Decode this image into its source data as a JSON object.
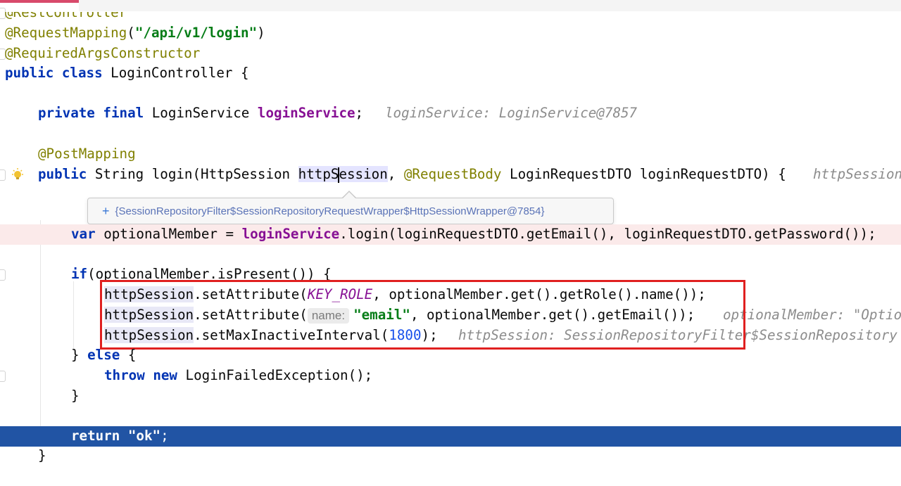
{
  "editor": {
    "lines": {
      "l1_annotation": "@RestController",
      "l2_annotation": "@RequestMapping",
      "l2_open": "(",
      "l2_path": "\"/api/v1/login\"",
      "l2_close": ")",
      "l3_annotation": "@RequiredArgsConstructor",
      "l4_kw": "public class",
      "l4_rest": " LoginController {",
      "l6_kw": "private final",
      "l6_type": " LoginService ",
      "l6_field": "loginService",
      "l6_semi": ";",
      "l6_hint": "loginService: LoginService@7857",
      "l8_annotation": "@PostMapping",
      "l9_kw": "public",
      "l9_a": " String login(HttpSession ",
      "l9_param_left": "httpS",
      "l9_param_right": "ession",
      "l9_comma": ", ",
      "l9_annotation": "@RequestBody",
      "l9_b": " LoginRequestDTO loginRequestDTO) {",
      "l9_hint": "httpSession",
      "l11_kw": "var",
      "l11_a": " optionalMember = ",
      "l11_field": "loginService",
      "l11_b": ".login(loginRequestDTO.getEmail(), loginRequestDTO.getPassword());",
      "l13_kw": "if",
      "l13_rest": "(optionalMember.isPresent()) {",
      "l14_var": "httpSession",
      "l14_a": ".setAttribute(",
      "l14_const": "KEY_ROLE",
      "l14_b": ", optionalMember.get().getRole().name());",
      "l15_var": "httpSession",
      "l15_a": ".setAttribute(",
      "l15_param_name": "name:",
      "l15_str": "\"email\"",
      "l15_b": ", optionalMember.get().getEmail());",
      "l15_hint": "optionalMember: \"Optio",
      "l16_var": "httpSession",
      "l16_a": ".setMaxInactiveInterval(",
      "l16_num": "1800",
      "l16_b": ");",
      "l16_hint": "httpSession: SessionRepositoryFilter$SessionRepository",
      "l17_close": "} ",
      "l17_kw": "else",
      "l17_rest": " {",
      "l18_kw1": "throw",
      "l18_kw2": "new",
      "l18_rest": " LoginFailedException();",
      "l19_close": "}",
      "l21_kw": "return",
      "l21_str": "\"ok\"",
      "l21_semi": ";",
      "l22_close": "}"
    },
    "popup": {
      "plus": "+",
      "text": "{SessionRepositoryFilter$SessionRepositoryRequestWrapper$HttpSessionWrapper@7854}"
    }
  },
  "colors": {
    "annotation": "#808000",
    "keyword": "#0033b3",
    "string": "#067d17",
    "field": "#871094",
    "number": "#1750eb",
    "execution_line": "#2154a4",
    "highlight_box": "#e02020"
  },
  "icons": {
    "intention": "lightbulb-icon",
    "fold": "fold-marker-icon"
  }
}
